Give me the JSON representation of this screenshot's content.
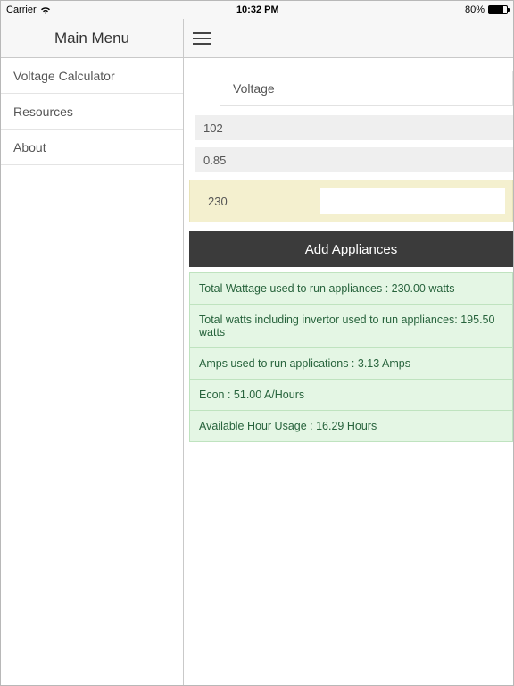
{
  "statusbar": {
    "carrier": "Carrier",
    "time": "10:32 PM",
    "battery": "80%"
  },
  "header": {
    "sidebar_title": "Main Menu"
  },
  "sidebar": {
    "items": [
      {
        "label": "Voltage Calculator"
      },
      {
        "label": "Resources"
      },
      {
        "label": "About"
      }
    ]
  },
  "main": {
    "voltage_card": "Voltage",
    "input1": "102",
    "input2": "0.85",
    "highlight_value": "230",
    "add_button": "Add Appliances",
    "results": [
      "Total Wattage used to run appliances : 230.00 watts",
      "Total watts including invertor used to run appliances: 195.50 watts",
      "Amps used to run applications : 3.13 Amps",
      "Econ : 51.00 A/Hours",
      "Available Hour Usage : 16.29 Hours"
    ]
  }
}
